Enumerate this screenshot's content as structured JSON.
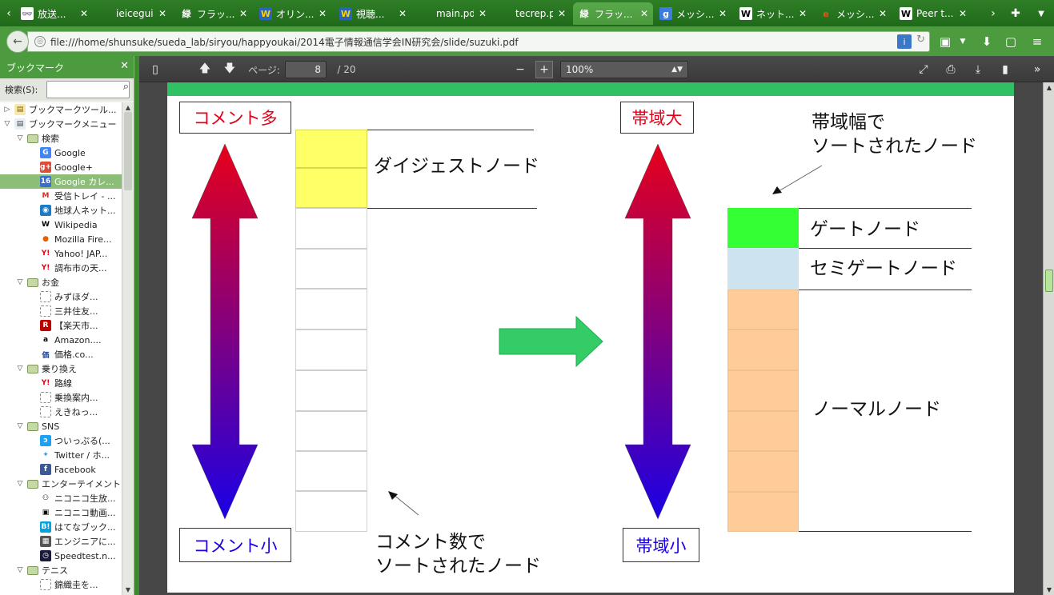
{
  "tabs": [
    {
      "title": "放送...",
      "fav": "👓",
      "favbg": "#ffffff",
      "favfg": "#333"
    },
    {
      "title": "ieiceguid...",
      "fav": "",
      "favbg": "transparent",
      "favfg": "#fff"
    },
    {
      "title": "フラッ...",
      "fav": "緑",
      "favbg": "transparent",
      "favfg": "#fff"
    },
    {
      "title": "オリン...",
      "fav": "W",
      "favbg": "#2b66b4",
      "favfg": "#ffd000"
    },
    {
      "title": "視聴...",
      "fav": "W",
      "favbg": "#2b66b4",
      "favfg": "#ffd000"
    },
    {
      "title": "main.pdf",
      "fav": "",
      "favbg": "transparent",
      "favfg": "#fff"
    },
    {
      "title": "tecrep.pdf",
      "fav": "",
      "favbg": "transparent",
      "favfg": "#fff"
    },
    {
      "title": "フラッ...",
      "fav": "緑",
      "favbg": "transparent",
      "favfg": "#fff",
      "active": true
    },
    {
      "title": "メッシ...",
      "fav": "g",
      "favbg": "#3b7de0",
      "favfg": "#fff"
    },
    {
      "title": "ネット...",
      "fav": "W",
      "favbg": "#ffffff",
      "favfg": "#000"
    },
    {
      "title": "メッシ...",
      "fav": "e",
      "favbg": "transparent",
      "favfg": "#e8541c"
    },
    {
      "title": "Peer t...",
      "fav": "W",
      "favbg": "#ffffff",
      "favfg": "#000"
    }
  ],
  "url": "file:///home/shunsuke/sueda_lab/siryou/happyoukai/2014電子情報通信学会IN研究会/slide/suzuki.pdf",
  "sidebar": {
    "title": "ブックマーク",
    "search_label": "検索(S):",
    "items": [
      {
        "label": "ブックマークツール...",
        "depth": 0,
        "tw": "▷",
        "icon": "toolbar",
        "sel": false
      },
      {
        "label": "ブックマークメニュー",
        "depth": 0,
        "tw": "▽",
        "icon": "menu",
        "sel": false
      },
      {
        "label": "検索",
        "depth": 1,
        "tw": "▽",
        "icon": "folder",
        "sel": false
      },
      {
        "label": "Google",
        "depth": 2,
        "tw": "",
        "icon": "g",
        "sel": false
      },
      {
        "label": "Google+",
        "depth": 2,
        "tw": "",
        "icon": "g+",
        "sel": false
      },
      {
        "label": "Google カレ...",
        "depth": 2,
        "tw": "",
        "icon": "16",
        "sel": true
      },
      {
        "label": "受信トレイ - ...",
        "depth": 2,
        "tw": "",
        "icon": "M",
        "sel": false
      },
      {
        "label": "地球人ネット...",
        "depth": 2,
        "tw": "",
        "icon": "net",
        "sel": false
      },
      {
        "label": "Wikipedia",
        "depth": 2,
        "tw": "",
        "icon": "W",
        "sel": false
      },
      {
        "label": "Mozilla Fire...",
        "depth": 2,
        "tw": "",
        "icon": "ff",
        "sel": false
      },
      {
        "label": "Yahoo! JAP...",
        "depth": 2,
        "tw": "",
        "icon": "Y",
        "sel": false
      },
      {
        "label": "調布市の天...",
        "depth": 2,
        "tw": "",
        "icon": "Y",
        "sel": false
      },
      {
        "label": "お金",
        "depth": 1,
        "tw": "▽",
        "icon": "folder",
        "sel": false
      },
      {
        "label": "みずほダ...",
        "depth": 2,
        "tw": "",
        "icon": "blank",
        "sel": false
      },
      {
        "label": "三井住友...",
        "depth": 2,
        "tw": "",
        "icon": "blank",
        "sel": false
      },
      {
        "label": "【楽天市...",
        "depth": 2,
        "tw": "",
        "icon": "R",
        "sel": false
      },
      {
        "label": "Amazon....",
        "depth": 2,
        "tw": "",
        "icon": "a",
        "sel": false
      },
      {
        "label": "価格.co...",
        "depth": 2,
        "tw": "",
        "icon": "kakaku",
        "sel": false
      },
      {
        "label": "乗り換え",
        "depth": 1,
        "tw": "▽",
        "icon": "folder",
        "sel": false
      },
      {
        "label": "路線",
        "depth": 2,
        "tw": "",
        "icon": "Y",
        "sel": false
      },
      {
        "label": "乗換案内...",
        "depth": 2,
        "tw": "",
        "icon": "blank",
        "sel": false
      },
      {
        "label": "えきねっ...",
        "depth": 2,
        "tw": "",
        "icon": "blank",
        "sel": false
      },
      {
        "label": "SNS",
        "depth": 1,
        "tw": "▽",
        "icon": "folder",
        "sel": false
      },
      {
        "label": "ついっぷる(...",
        "depth": 2,
        "tw": "",
        "icon": "tw2",
        "sel": false
      },
      {
        "label": "Twitter / ホ...",
        "depth": 2,
        "tw": "",
        "icon": "twitter",
        "sel": false
      },
      {
        "label": "Facebook",
        "depth": 2,
        "tw": "",
        "icon": "f",
        "sel": false
      },
      {
        "label": "エンターテイメント",
        "depth": 1,
        "tw": "▽",
        "icon": "folder",
        "sel": false
      },
      {
        "label": "ニコニコ生放...",
        "depth": 2,
        "tw": "",
        "icon": "nico",
        "sel": false
      },
      {
        "label": "ニコニコ動画...",
        "depth": 2,
        "tw": "",
        "icon": "tv",
        "sel": false
      },
      {
        "label": "はてなブック...",
        "depth": 2,
        "tw": "",
        "icon": "B!",
        "sel": false
      },
      {
        "label": "エンジニアに...",
        "depth": 2,
        "tw": "",
        "icon": "eng",
        "sel": false
      },
      {
        "label": "Speedtest.n...",
        "depth": 2,
        "tw": "",
        "icon": "speed",
        "sel": false
      },
      {
        "label": "テニス",
        "depth": 1,
        "tw": "▽",
        "icon": "folder",
        "sel": false
      },
      {
        "label": "錦織圭を...",
        "depth": 2,
        "tw": "",
        "icon": "blank",
        "sel": false
      }
    ]
  },
  "pdf": {
    "page_label": "ページ:",
    "page": "8",
    "total": "/ 20",
    "zoom": "100%",
    "zoom_minus": "−",
    "zoom_plus": "+"
  },
  "slide": {
    "comment_high": "コメント多",
    "comment_low": "コメント小",
    "band_high": "帯域大",
    "band_low": "帯域小",
    "digest_node": "ダイジェストノード",
    "sorted_by_comments": "コメント数で\nソートされたノード",
    "sorted_by_band": "帯域幅で\nソートされたノード",
    "gate_node": "ゲートノード",
    "semigate_node": "セミゲートノード",
    "normal_node": "ノーマルノード",
    "colors": {
      "red": "#e8001a",
      "blue": "#1a00e6",
      "digest": "#ffff66",
      "gate": "#33ff33",
      "semigate": "#cde3f0",
      "normal": "#ffcc99",
      "arrow": "#33cc66",
      "accent": "#31c062"
    }
  }
}
